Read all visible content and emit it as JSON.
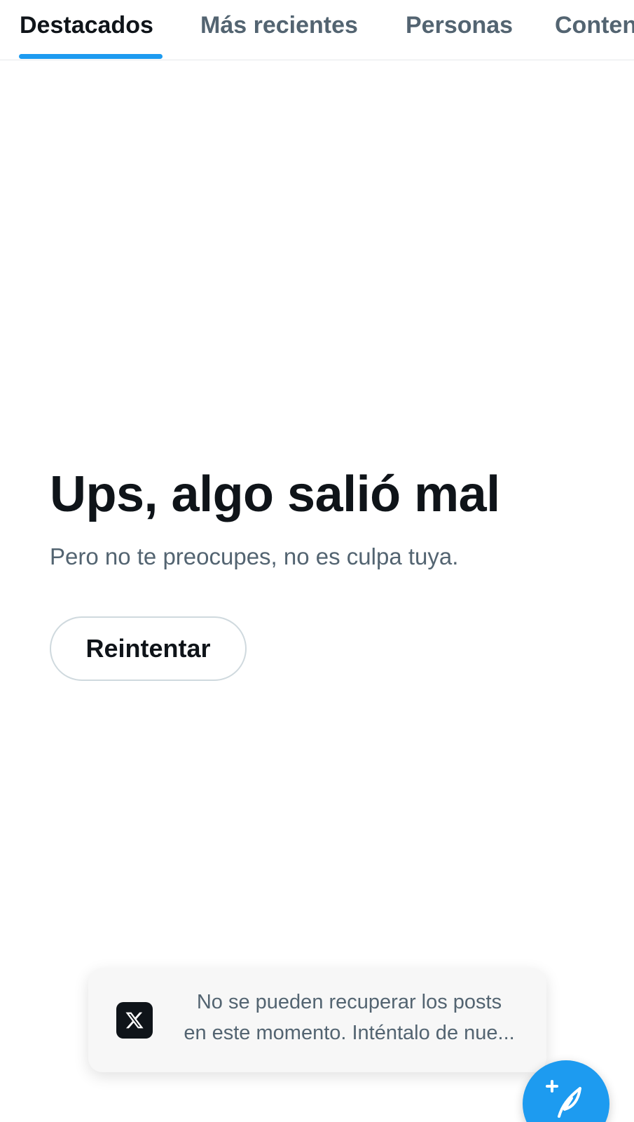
{
  "tabs": {
    "items": [
      {
        "label": "Destacados",
        "active": true
      },
      {
        "label": "Más recientes",
        "active": false
      },
      {
        "label": "Personas",
        "active": false
      },
      {
        "label": "Conten",
        "active": false
      }
    ]
  },
  "error": {
    "title": "Ups, algo salió mal",
    "subtitle": "Pero no te preocupes, no es culpa tuya.",
    "retry_label": "Reintentar"
  },
  "toast": {
    "logo_icon": "x-logo-icon",
    "line1": "No se pueden recuperar los posts",
    "line2": "en este momento. Inténtalo de nue..."
  },
  "fab": {
    "icon": "compose-post-icon"
  },
  "colors": {
    "accent": "#1d9bf0",
    "text_primary": "#0f1419",
    "text_secondary": "#536471",
    "border": "#cfd9de"
  }
}
